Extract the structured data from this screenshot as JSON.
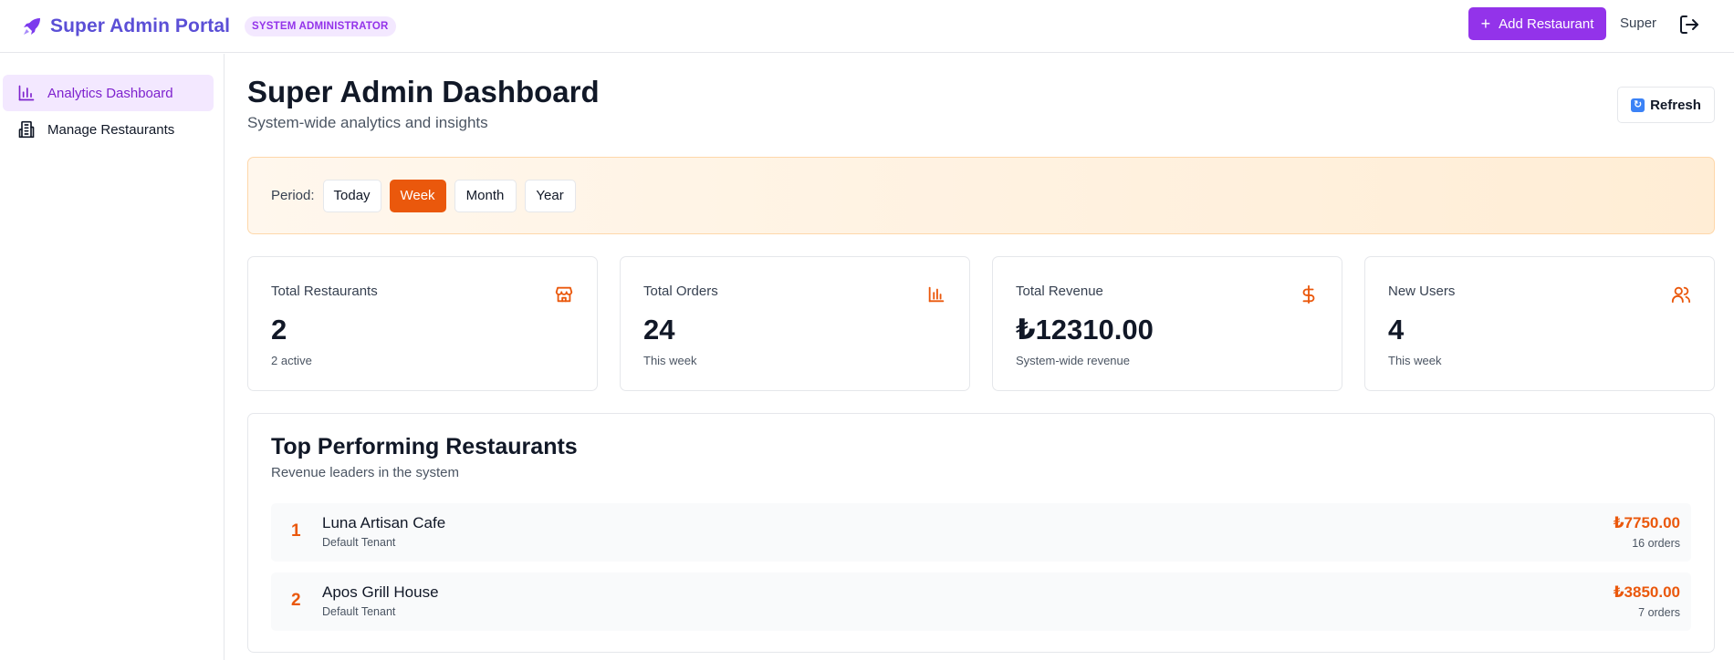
{
  "header": {
    "title": "Super Admin Portal",
    "role_badge": "SYSTEM ADMINISTRATOR",
    "add_button_label": "Add Restaurant",
    "user_name": "Super",
    "accent_color": "#9333ea",
    "brand_color": "#5b4fd6"
  },
  "sidebar": {
    "items": [
      {
        "label": "Analytics Dashboard",
        "icon": "bar-chart-icon",
        "active": true
      },
      {
        "label": "Manage Restaurants",
        "icon": "building-icon",
        "active": false
      }
    ]
  },
  "page": {
    "title": "Super Admin Dashboard",
    "subtitle": "System-wide analytics and insights",
    "refresh_label": "Refresh"
  },
  "period": {
    "label": "Period:",
    "options": [
      "Today",
      "Week",
      "Month",
      "Year"
    ],
    "selected": "Week",
    "active_color": "#ea580c"
  },
  "stats": [
    {
      "label": "Total Restaurants",
      "value": "2",
      "sub": "2 active",
      "icon": "store-icon"
    },
    {
      "label": "Total Orders",
      "value": "24",
      "sub": "This week",
      "icon": "bar-chart-icon"
    },
    {
      "label": "Total Revenue",
      "value": "₺12310.00",
      "sub": "System-wide revenue",
      "icon": "dollar-icon"
    },
    {
      "label": "New Users",
      "value": "4",
      "sub": "This week",
      "icon": "users-icon"
    }
  ],
  "top_restaurants": {
    "title": "Top Performing Restaurants",
    "subtitle": "Revenue leaders in the system",
    "rows": [
      {
        "rank": "1",
        "name": "Luna Artisan Cafe",
        "tenant": "Default Tenant",
        "revenue": "₺7750.00",
        "orders": "16 orders"
      },
      {
        "rank": "2",
        "name": "Apos Grill House",
        "tenant": "Default Tenant",
        "revenue": "₺3850.00",
        "orders": "7 orders"
      }
    ]
  }
}
